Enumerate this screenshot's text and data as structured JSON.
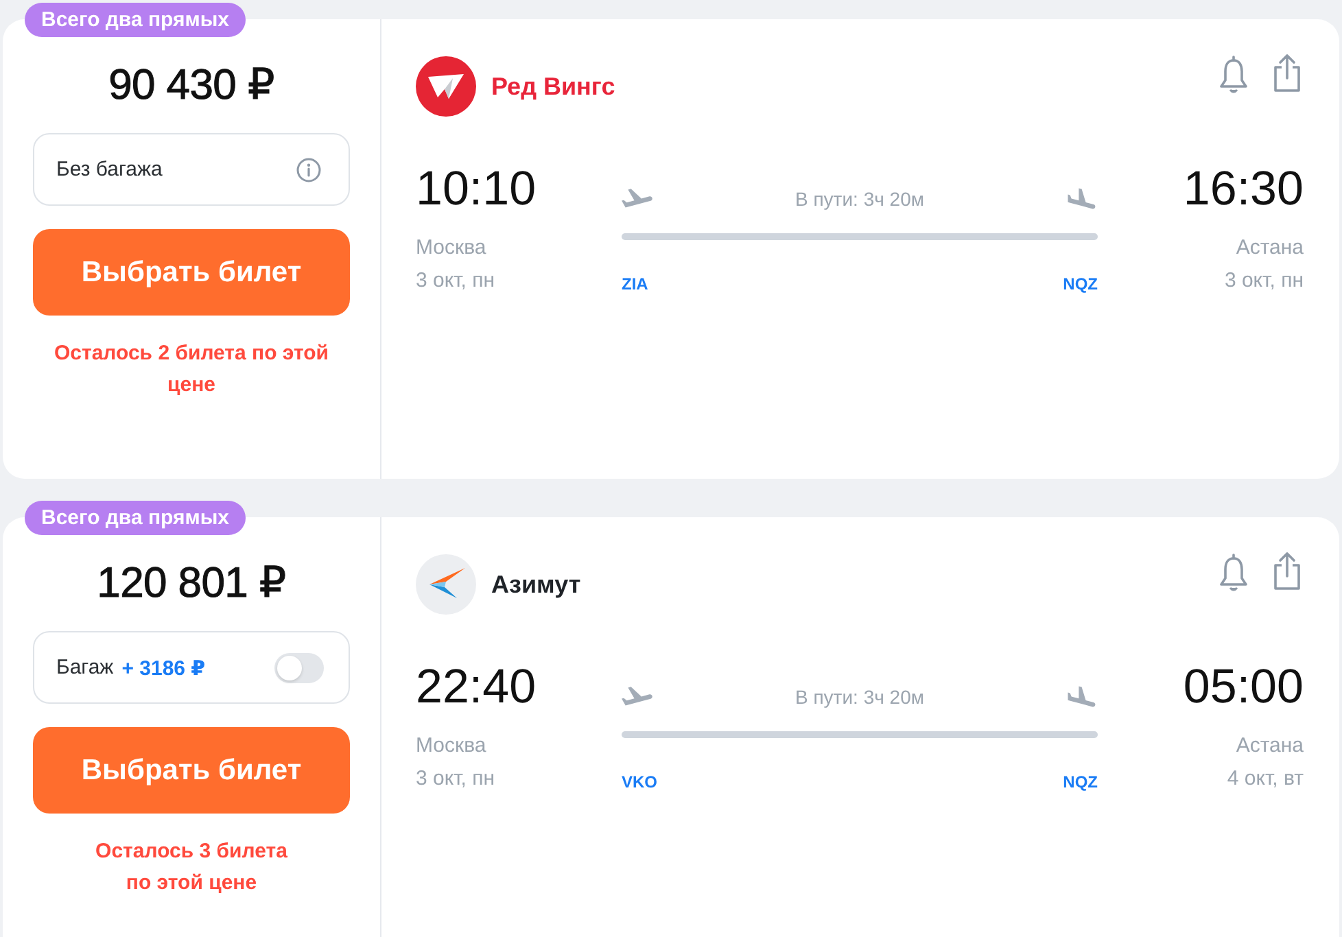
{
  "offers": [
    {
      "badge": "Всего два прямых",
      "price": "90 430 ₽",
      "baggage": {
        "kind": "info",
        "label": "Без багажа"
      },
      "button": "Выбрать билет",
      "warning": "Осталось 2 билета по этой\nцене",
      "airline": {
        "kind": "wings",
        "name": "Ред Вингс",
        "color": "#e8253a"
      },
      "departure": {
        "time": "10:10",
        "city": "Москва",
        "date": "3 окт, пн",
        "airport": "ZIA"
      },
      "duration": "В пути: 3ч 20м",
      "arrival": {
        "time": "16:30",
        "city": "Астана",
        "date": "3 окт, пн",
        "airport": "NQZ"
      }
    },
    {
      "badge": "Всего два прямых",
      "price": "120 801 ₽",
      "baggage": {
        "kind": "toggle",
        "label": "Багаж",
        "price": "+ 3186 ₽",
        "on": false
      },
      "button": "Выбрать билет",
      "warning": "Осталось 3 билета\nпо этой цене",
      "airline": {
        "kind": "chevron",
        "name": "Азимут",
        "color": "#1f2328"
      },
      "departure": {
        "time": "22:40",
        "city": "Москва",
        "date": "3 окт, пн",
        "airport": "VKO"
      },
      "duration": "В пути: 3ч 20м",
      "arrival": {
        "time": "05:00",
        "city": "Астана",
        "date": "4 окт, вт",
        "airport": "NQZ"
      }
    }
  ]
}
